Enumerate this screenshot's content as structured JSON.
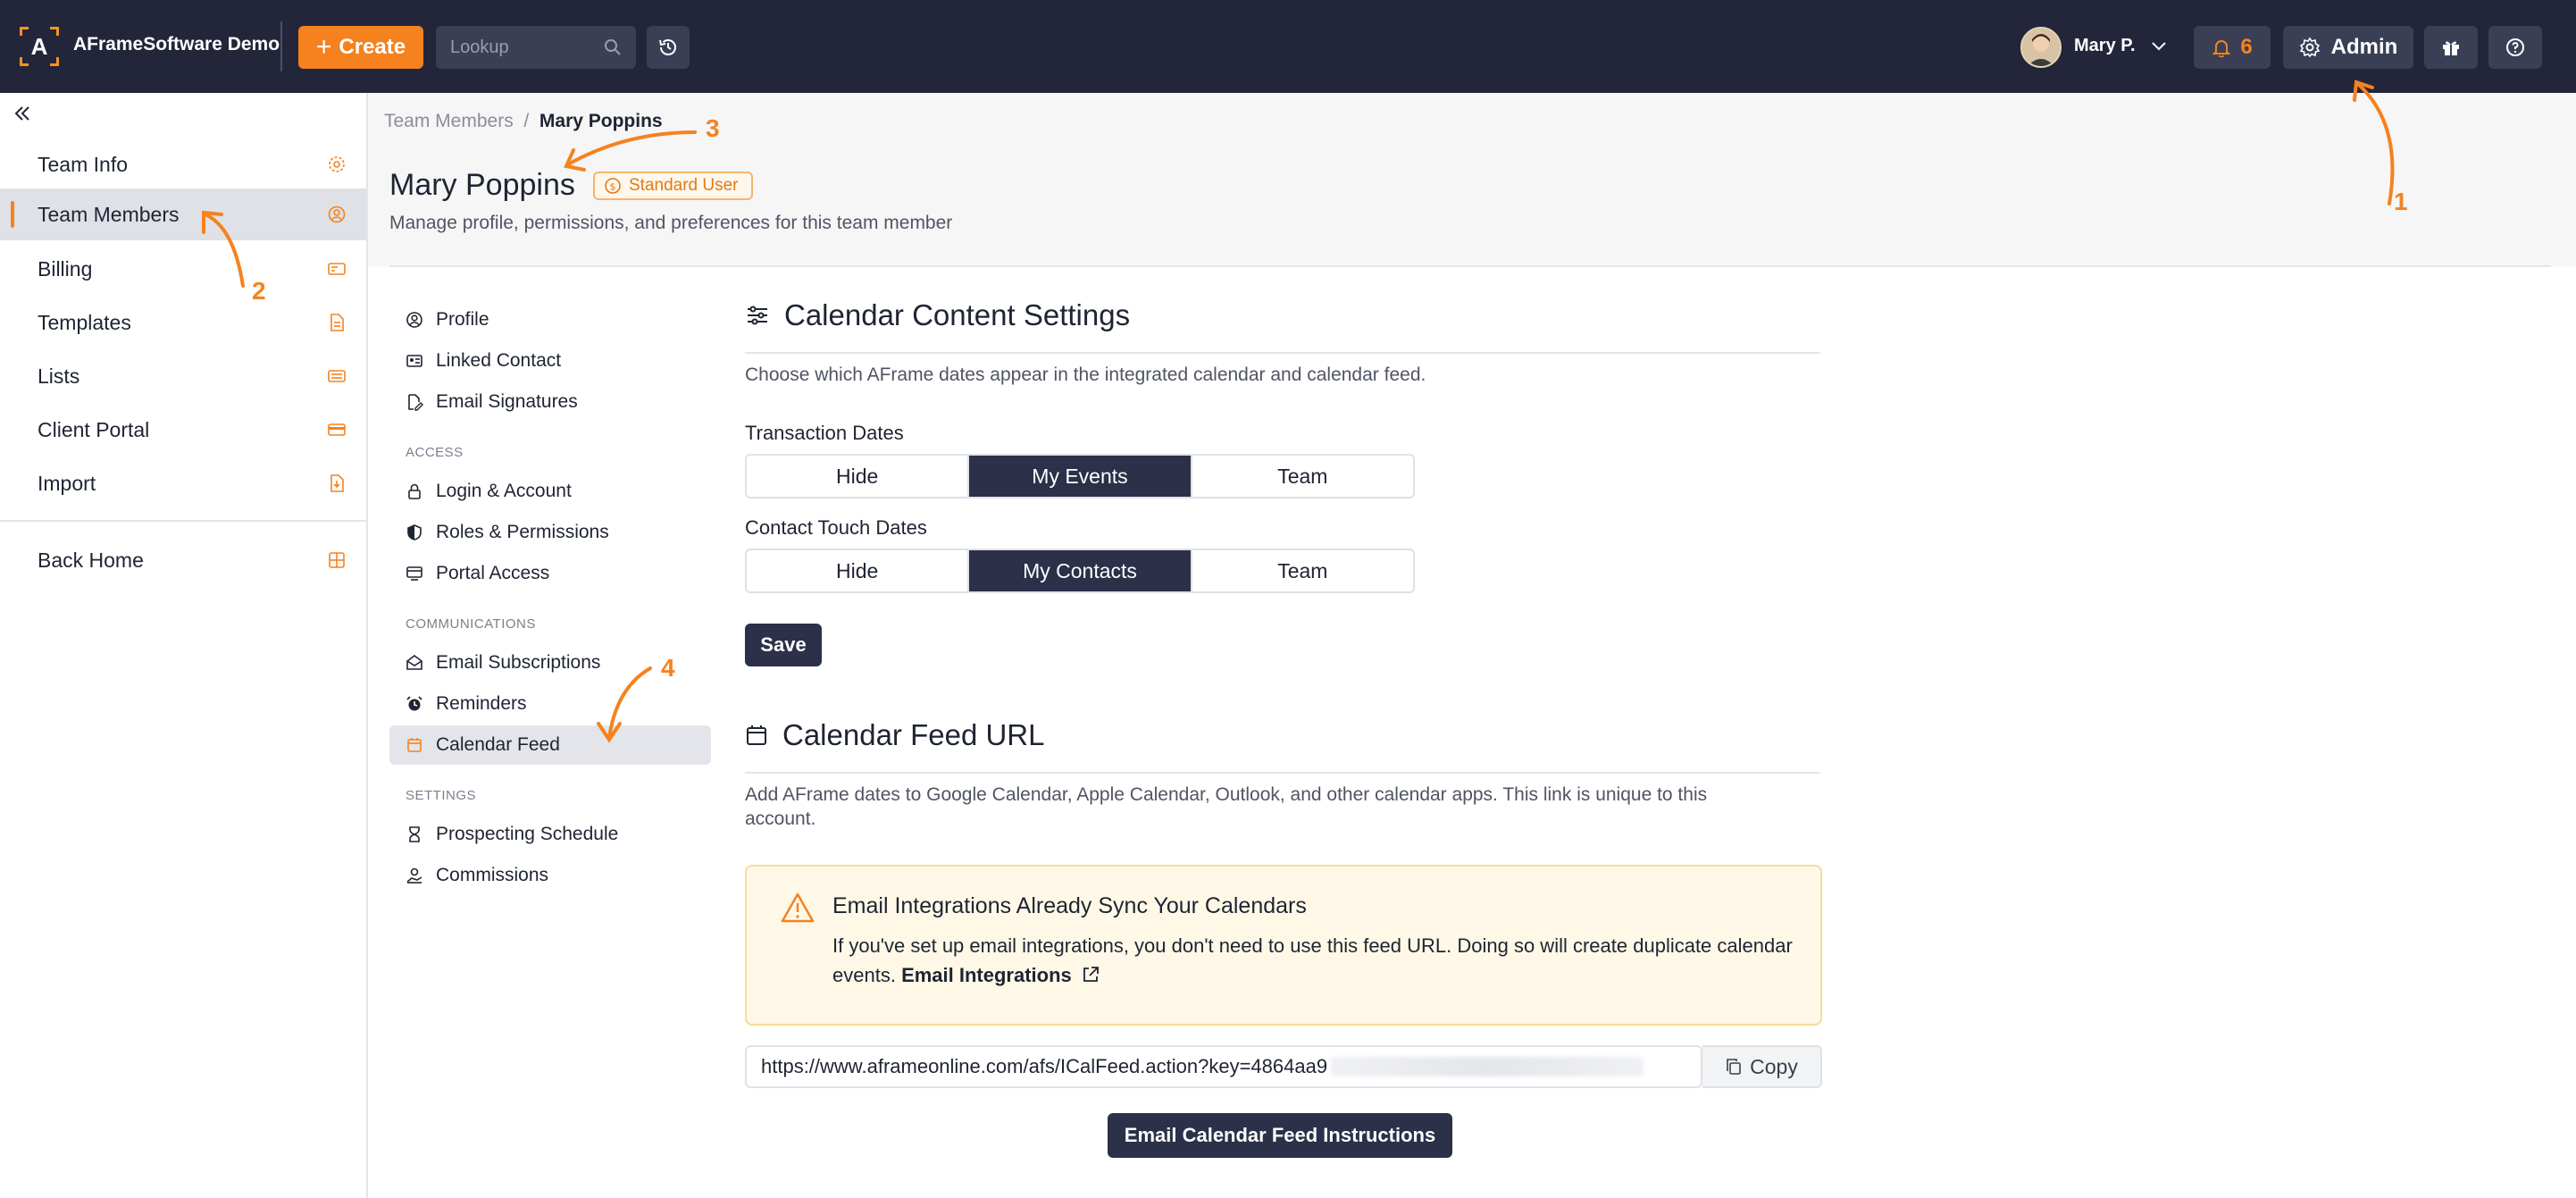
{
  "app": {
    "brand": "AFrameSoftware Demo",
    "logo_letter": "A"
  },
  "topbar": {
    "create_label": "Create",
    "lookup_placeholder": "Lookup",
    "user_name": "Mary P.",
    "notification_count": "6",
    "admin_label": "Admin"
  },
  "sidebar": {
    "items": [
      {
        "label": "Team Info",
        "icon": "gear-icon"
      },
      {
        "label": "Team Members",
        "icon": "user-circle-icon",
        "active": true
      },
      {
        "label": "Billing",
        "icon": "billing-icon"
      },
      {
        "label": "Templates",
        "icon": "document-icon"
      },
      {
        "label": "Lists",
        "icon": "list-icon"
      },
      {
        "label": "Client Portal",
        "icon": "portal-icon"
      },
      {
        "label": "Import",
        "icon": "import-icon"
      }
    ],
    "back_home": "Back Home"
  },
  "breadcrumb": {
    "parent": "Team Members",
    "separator": "/",
    "current": "Mary Poppins"
  },
  "page": {
    "title": "Mary Poppins",
    "badge": "Standard User",
    "subtitle": "Manage profile, permissions, and preferences for this team member"
  },
  "subnav": {
    "top": [
      "Profile",
      "Linked Contact",
      "Email Signatures"
    ],
    "access_heading": "ACCESS",
    "access": [
      "Login & Account",
      "Roles & Permissions",
      "Portal Access"
    ],
    "comm_heading": "COMMUNICATIONS",
    "comm": [
      "Email Subscriptions",
      "Reminders",
      "Calendar Feed"
    ],
    "settings_heading": "SETTINGS",
    "settings": [
      "Prospecting Schedule",
      "Commissions"
    ],
    "active": "Calendar Feed"
  },
  "content_settings": {
    "title": "Calendar Content Settings",
    "description": "Choose which AFrame dates appear in the integrated calendar and calendar feed.",
    "transaction_label": "Transaction Dates",
    "transaction_options": [
      "Hide",
      "My Events",
      "Team"
    ],
    "transaction_selected": "My Events",
    "contact_label": "Contact Touch Dates",
    "contact_options": [
      "Hide",
      "My Contacts",
      "Team"
    ],
    "contact_selected": "My Contacts",
    "save_label": "Save"
  },
  "feed": {
    "title": "Calendar Feed URL",
    "description": "Add AFrame dates to Google Calendar, Apple Calendar, Outlook, and other calendar apps. This link is unique to this account.",
    "alert_title": "Email Integrations Already Sync Your Calendars",
    "alert_body": "If you've set up email integrations, you don't need to use this feed URL. Doing so will create duplicate calendar events.",
    "alert_link": "Email Integrations",
    "url": "https://www.aframeonline.com/afs/ICalFeed.action?key=4864aa9",
    "copy_label": "Copy",
    "email_button": "Email Calendar Feed Instructions"
  },
  "annotations": [
    "1",
    "2",
    "3",
    "4"
  ],
  "colors": {
    "accent": "#f5821f",
    "topbar": "#23263a",
    "dark_button": "#2c3048"
  }
}
